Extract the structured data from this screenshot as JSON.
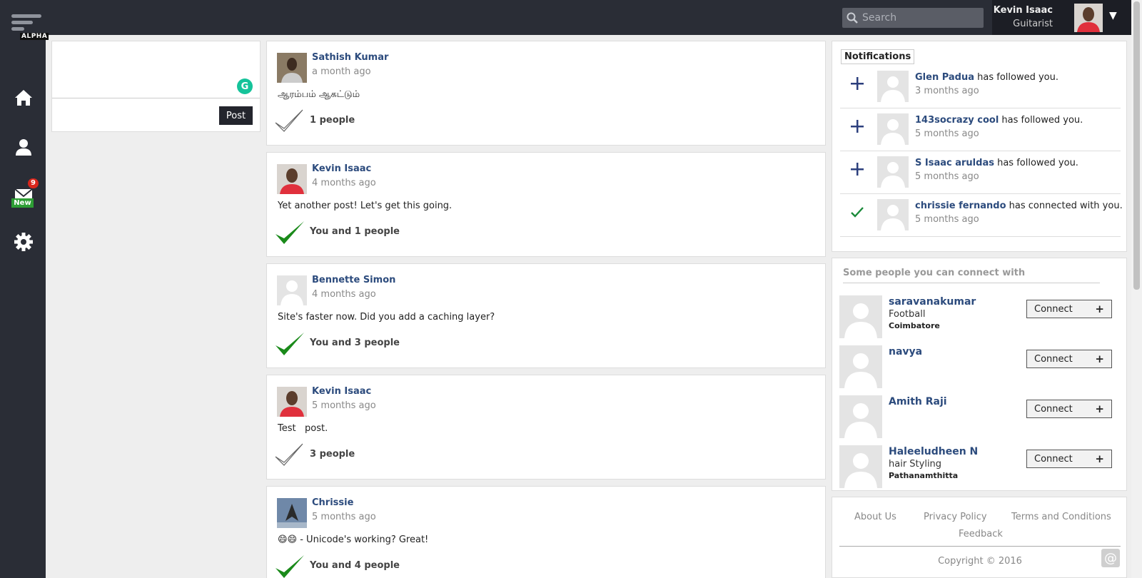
{
  "brand": {
    "tag": "ALPHA"
  },
  "nav": {
    "mail_badge": "9",
    "mail_new": "New",
    "icons": [
      "home-icon",
      "user-icon",
      "mail-icon",
      "gear-icon"
    ]
  },
  "search": {
    "placeholder": "Search"
  },
  "user": {
    "name": "Kevin Isaac",
    "role": "Guitarist"
  },
  "composer": {
    "post_label": "Post",
    "grammarly": "G"
  },
  "feed": [
    {
      "author": "Sathish Kumar",
      "time": "a month ago",
      "body": "ஆரம்பம் ஆகட்டும்",
      "liked": false,
      "likes": "1 people"
    },
    {
      "author": "Kevin Isaac",
      "time": "4 months ago",
      "body": "Yet another post! Let's get this going.",
      "liked": true,
      "likes": "You and 1 people"
    },
    {
      "author": "Bennette Simon",
      "time": "4 months ago",
      "body": "Site's faster now. Did you add a caching layer?",
      "liked": true,
      "likes": "You and 3 people"
    },
    {
      "author": "Kevin Isaac",
      "time": "5 months ago",
      "body": "Test   post.",
      "liked": false,
      "likes": "3 people"
    },
    {
      "author": "Chrissie",
      "time": "5 months ago",
      "body": "😄😄 - Unicode's working? Great!",
      "liked": true,
      "likes": "You and 4 people"
    }
  ],
  "notifications": {
    "title": "Notifications",
    "items": [
      {
        "type": "follow",
        "name": "Glen Padua",
        "action": " has followed you.",
        "time": "3 months ago"
      },
      {
        "type": "follow",
        "name": "143socrazy cool",
        "action": " has followed you.",
        "time": "5 months ago"
      },
      {
        "type": "follow",
        "name": "S Isaac aruldas",
        "action": " has followed you.",
        "time": "5 months ago"
      },
      {
        "type": "connect",
        "name": "chrissie fernando",
        "action": " has connected with you.",
        "time": "5 months ago"
      }
    ]
  },
  "suggestions": {
    "title": "Some people you can connect with",
    "connect_label": "Connect",
    "people": [
      {
        "name": "saravanakumar",
        "hobby": "Football",
        "location": "Coimbatore"
      },
      {
        "name": "navya",
        "hobby": "",
        "location": ""
      },
      {
        "name": "Amith Raji",
        "hobby": "",
        "location": ""
      },
      {
        "name": "Haleeludheen N",
        "hobby": "hair Styling",
        "location": "Pathanamthitta"
      }
    ]
  },
  "footer": {
    "about": "About Us",
    "privacy": "Privacy Policy",
    "terms": "Terms and Conditions",
    "feedback": "Feedback",
    "copyright": "Copyright © 2016",
    "at": "@"
  },
  "colors": {
    "dark": "#2a2d36",
    "link": "#2c4b7d",
    "like": "#1a8a1a",
    "badge": "#d9261c",
    "new": "#2e9e35"
  }
}
